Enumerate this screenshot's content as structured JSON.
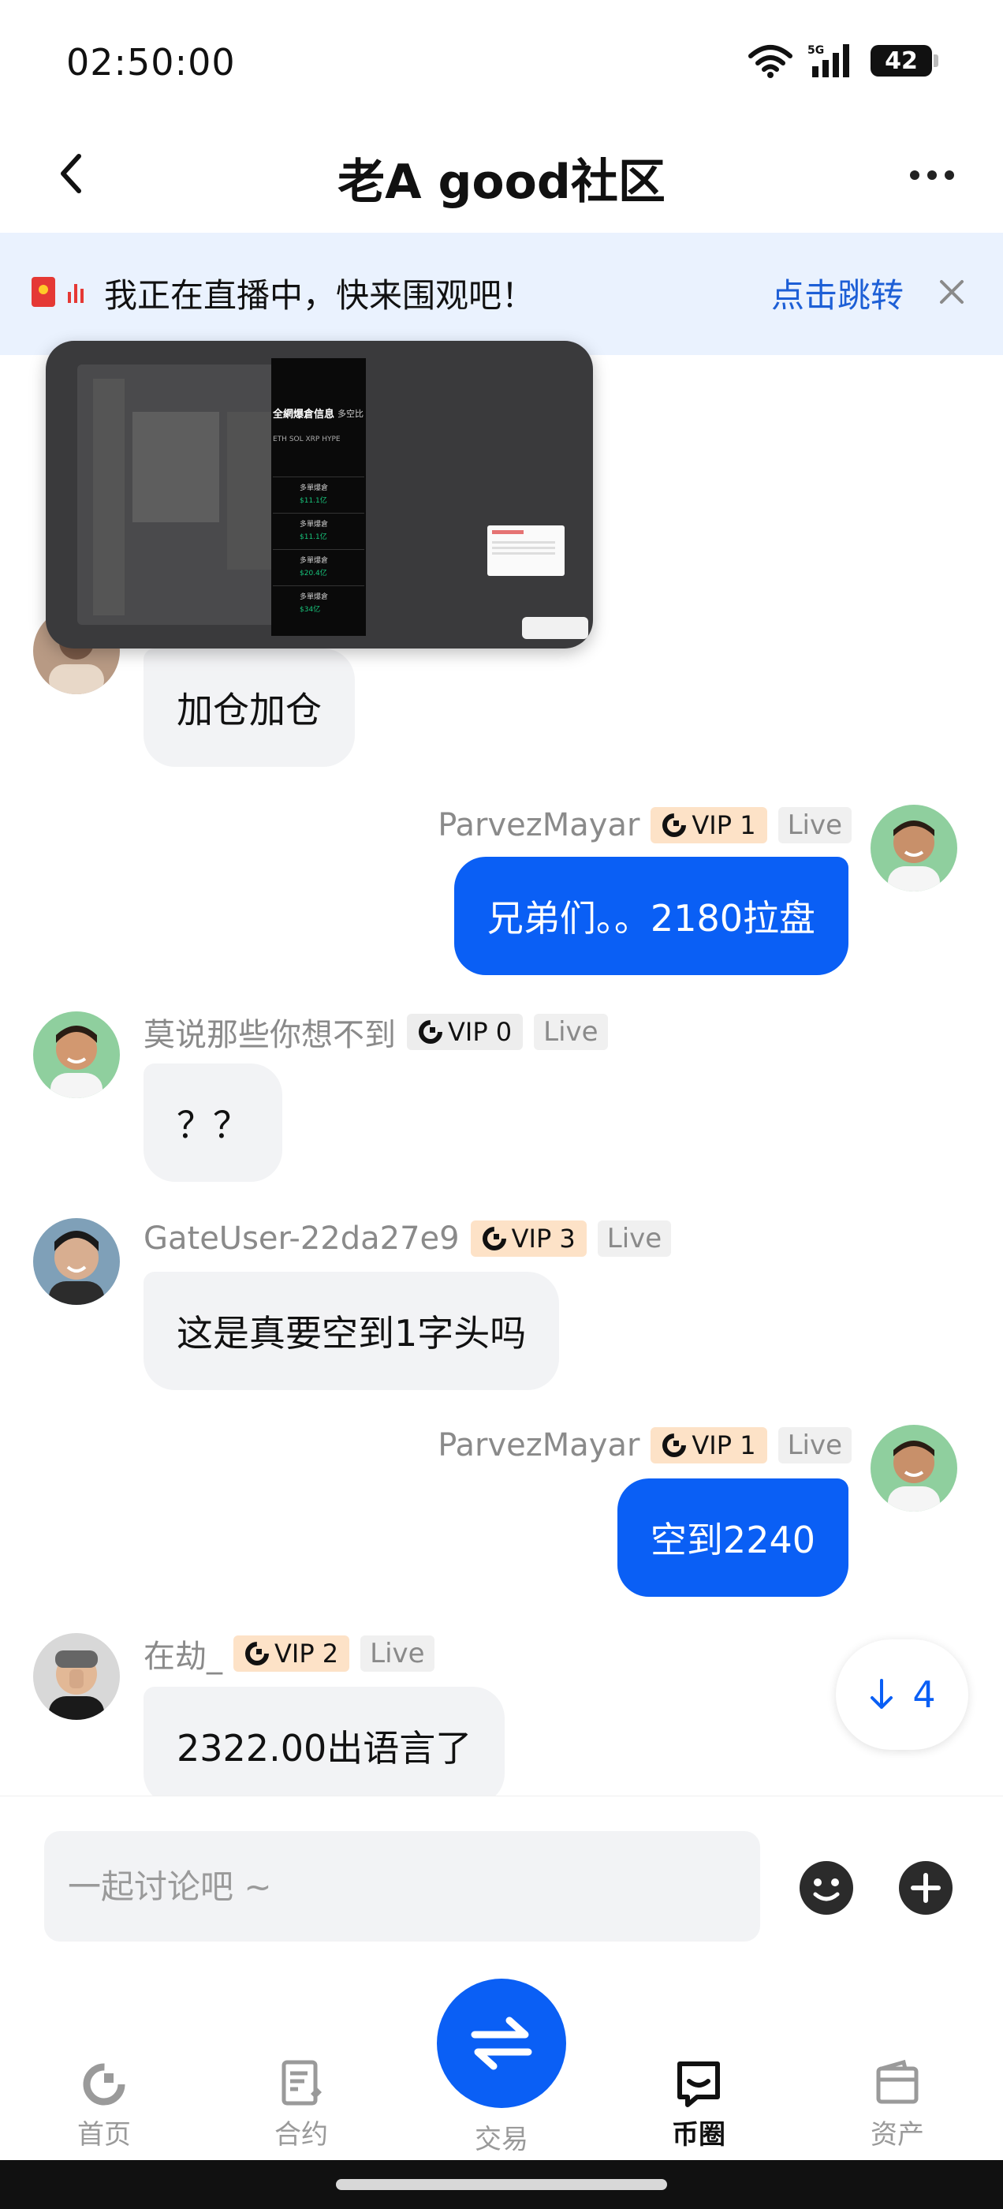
{
  "status_bar": {
    "time": "02:50:00",
    "network": "5G",
    "battery": "42"
  },
  "header": {
    "title": "老A good社区"
  },
  "live_banner": {
    "text": "我正在直播中，快来围观吧！",
    "link": "点击跳转"
  },
  "live_preview": {
    "title": "全網爆倉信息",
    "tab": "多空比",
    "coins": "ETH    SOL    XRP    HYPE",
    "rows": [
      {
        "label": "多單爆倉",
        "value": "$11.1亿"
      },
      {
        "label": "多單爆倉",
        "value": "$11.1亿"
      },
      {
        "label": "多單爆倉",
        "value": "$20.4亿"
      },
      {
        "label": "多單爆倉",
        "value": "$34亿"
      }
    ]
  },
  "messages": [
    {
      "side": "left",
      "text": "加仓加仓"
    },
    {
      "side": "right",
      "user": "ParvezMayar",
      "vip": "VIP 1",
      "live": "Live",
      "text": "兄弟们。。2180拉盘"
    },
    {
      "side": "left",
      "user": "莫说那些你想不到",
      "vip": "VIP 0",
      "live": "Live",
      "text": "？？"
    },
    {
      "side": "left",
      "user": "GateUser-22da27e9",
      "vip": "VIP 3",
      "live": "Live",
      "text": "这是真要空到1字头吗"
    },
    {
      "side": "right",
      "user": "ParvezMayar",
      "vip": "VIP 1",
      "live": "Live",
      "text": "空到2240"
    },
    {
      "side": "left",
      "user": "在劫_",
      "vip": "VIP 2",
      "live": "Live",
      "text": "2322.00出语言了"
    }
  ],
  "scroll_down": {
    "count": "4"
  },
  "input": {
    "placeholder": "一起讨论吧 ~"
  },
  "nav": {
    "items": [
      {
        "label": "首页"
      },
      {
        "label": "合约"
      },
      {
        "label": "交易"
      },
      {
        "label": "币圈"
      },
      {
        "label": "资产"
      }
    ],
    "active": "币圈"
  },
  "colors": {
    "accent": "#0a5ff5",
    "link": "#1d5fd6",
    "banner_bg": "#eaf2fe",
    "vip_orange": "#fde2c7",
    "bubble_other": "#f2f3f5"
  }
}
